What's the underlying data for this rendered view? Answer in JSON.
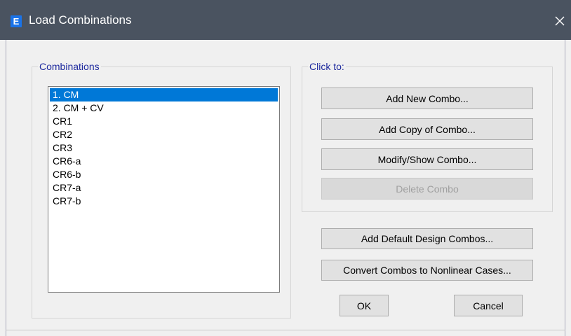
{
  "window": {
    "title": "Load Combinations",
    "app_icon_letter": "E",
    "close_glyph": "✕"
  },
  "combinations": {
    "legend": "Combinations",
    "items": [
      "1. CM",
      "2. CM + CV",
      "CR1",
      "CR2",
      "CR3",
      "CR6-a",
      "CR6-b",
      "CR7-a",
      "CR7-b"
    ],
    "selected_index": 0
  },
  "click_to": {
    "legend": "Click to:",
    "add_new": "Add New Combo...",
    "add_copy": "Add Copy of Combo...",
    "modify_show": "Modify/Show Combo...",
    "delete": "Delete Combo"
  },
  "extra_buttons": {
    "add_default": "Add Default Design Combos...",
    "convert": "Convert Combos to Nonlinear Cases..."
  },
  "footer": {
    "ok": "OK",
    "cancel": "Cancel"
  },
  "colors": {
    "titlebar": "#4a5360",
    "selection": "#0078d7",
    "legend_text": "#1e2a9e",
    "app_icon": "#1a73e8"
  }
}
